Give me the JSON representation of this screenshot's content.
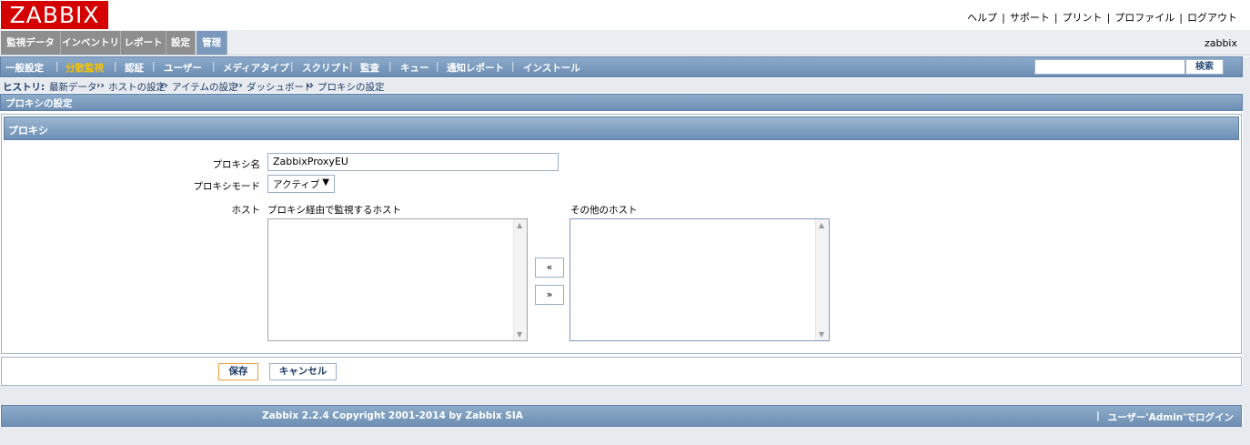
{
  "header": {
    "logo": "ZABBIX",
    "links": [
      "ヘルプ",
      "サポート",
      "プリント",
      "プロファイル",
      "ログアウト"
    ],
    "separator": "|"
  },
  "main_menu": {
    "tabs": [
      "監視データ",
      "インベントリ",
      "レポート",
      "設定",
      "管理"
    ],
    "active": "管理",
    "user": "zabbix"
  },
  "sub_menu": {
    "items": [
      "一般設定",
      "分散監視",
      "認証",
      "ユーザー",
      "メディアタイプ",
      "スクリプト",
      "監査",
      "キュー",
      "通知レポート",
      "インストール"
    ],
    "active": "分散監視",
    "search_value": "",
    "search_button": "検索"
  },
  "history": {
    "label": "ヒストリ:",
    "items": [
      "最新データ",
      "ホストの設定",
      "アイテムの設定",
      "ダッシュボード",
      "プロキシの設定"
    ],
    "arrow": "››"
  },
  "page_title": "プロキシの設定",
  "form": {
    "header": "プロキシ",
    "name_label": "プロキシ名",
    "name_value": "ZabbixProxyEU",
    "mode_label": "プロキシモード",
    "mode_value": "アクティブ",
    "hosts_label": "ホスト",
    "monitored_label": "プロキシ経由で監視するホスト",
    "other_label": "その他のホスト",
    "add_button": "«",
    "remove_button": "»"
  },
  "buttons": {
    "save": "保存",
    "cancel": "キャンセル"
  },
  "footer": {
    "copyright": "Zabbix 2.2.4 Copyright 2001-2014 by Zabbix SIA",
    "separator": "|",
    "login": "ユーザー'Admin'でログイン"
  },
  "colors": {
    "brand_red": "#d40000",
    "menu_blue": "#6d8fb4",
    "active_submenu": "#f6c400"
  }
}
